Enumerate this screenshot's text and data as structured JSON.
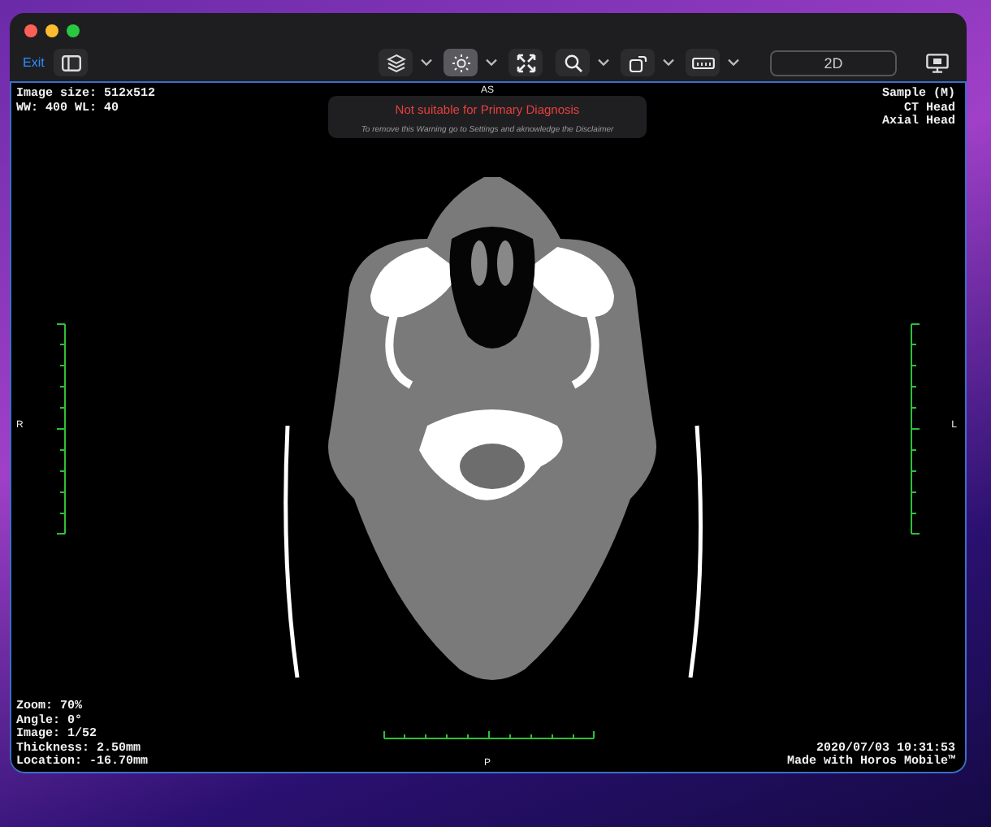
{
  "toolbar": {
    "exit": "Exit",
    "tools": [
      {
        "kind": "layers",
        "selected": false,
        "menu": true
      },
      {
        "kind": "brightness",
        "selected": true,
        "menu": true
      },
      {
        "kind": "fit",
        "selected": false,
        "menu": false
      },
      {
        "kind": "zoom",
        "selected": false,
        "menu": true
      },
      {
        "kind": "rotate",
        "selected": false,
        "menu": true
      },
      {
        "kind": "ruler",
        "selected": false,
        "menu": true
      }
    ],
    "mode": "2D"
  },
  "viewer": {
    "top_left": [
      "Image size: 512x512",
      "WW: 400 WL: 40"
    ],
    "top_right": [
      "Sample (M)",
      "CT Head",
      "Axial Head"
    ],
    "bottom_left": [
      "Zoom: 70%",
      "Angle: 0°",
      "Image: 1/52",
      "Thickness: 2.50mm",
      "Location: -16.70mm"
    ],
    "bottom_right": [
      "2020/07/03 10:31:53",
      "Made with Horos Mobile™"
    ],
    "orientation": {
      "top": "AS",
      "left": "R",
      "right": "L",
      "bottom": "P"
    },
    "warning": {
      "title": "Not suitable for Primary Diagnosis",
      "message": "To remove this Warning go to Settings and aknowledge the Disclaimer"
    }
  }
}
